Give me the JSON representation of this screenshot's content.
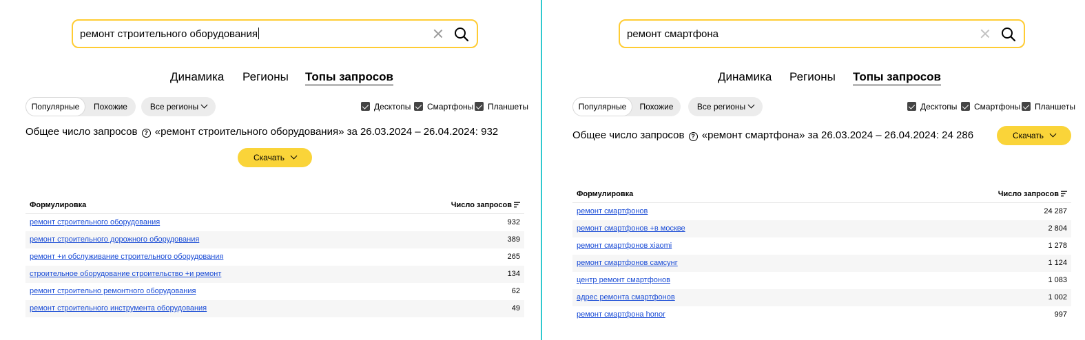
{
  "tabs": [
    "Динамика",
    "Регионы",
    "Топы запросов"
  ],
  "segment": [
    "Популярные",
    "Похожие"
  ],
  "regions_label": "Все регионы",
  "devices": [
    "Десктопы",
    "Смартфоны",
    "Планшеты"
  ],
  "download_label": "Скачать",
  "table_headers": {
    "phrase": "Формулировка",
    "count": "Число запросов"
  },
  "left": {
    "search_value": "ремонт строительного оборудования",
    "total_text": "Общее число запросов",
    "total_query": "«ремонт строительного оборудования» за 26.03.2024 – 26.04.2024: 932",
    "rows": [
      {
        "phrase": "ремонт строительного оборудования",
        "count": "932"
      },
      {
        "phrase": "ремонт строительного дорожного оборудования",
        "count": "389"
      },
      {
        "phrase": "ремонт +и обслуживание строительного оборудования",
        "count": "265"
      },
      {
        "phrase": "строительное оборудование строительство +и ремонт",
        "count": "134"
      },
      {
        "phrase": "ремонт строительно ремонтного оборудования",
        "count": "62"
      },
      {
        "phrase": "ремонт строительного инструмента оборудования",
        "count": "49"
      }
    ]
  },
  "right": {
    "search_value": "ремонт смартфона",
    "total_text": "Общее число запросов",
    "total_query": "«ремонт смартфона» за 26.03.2024 – 26.04.2024: 24 286",
    "rows": [
      {
        "phrase": "ремонт смартфонов",
        "count": "24 287"
      },
      {
        "phrase": "ремонт смартфонов +в москве",
        "count": "2 804"
      },
      {
        "phrase": "ремонт смартфонов xiaomi",
        "count": "1 278"
      },
      {
        "phrase": "ремонт смартфонов самсунг",
        "count": "1 124"
      },
      {
        "phrase": "центр ремонт смартфонов",
        "count": "1 083"
      },
      {
        "phrase": "адрес ремонта смартфонов",
        "count": "1 002"
      },
      {
        "phrase": "ремонт смартфона honor",
        "count": "997"
      }
    ]
  }
}
